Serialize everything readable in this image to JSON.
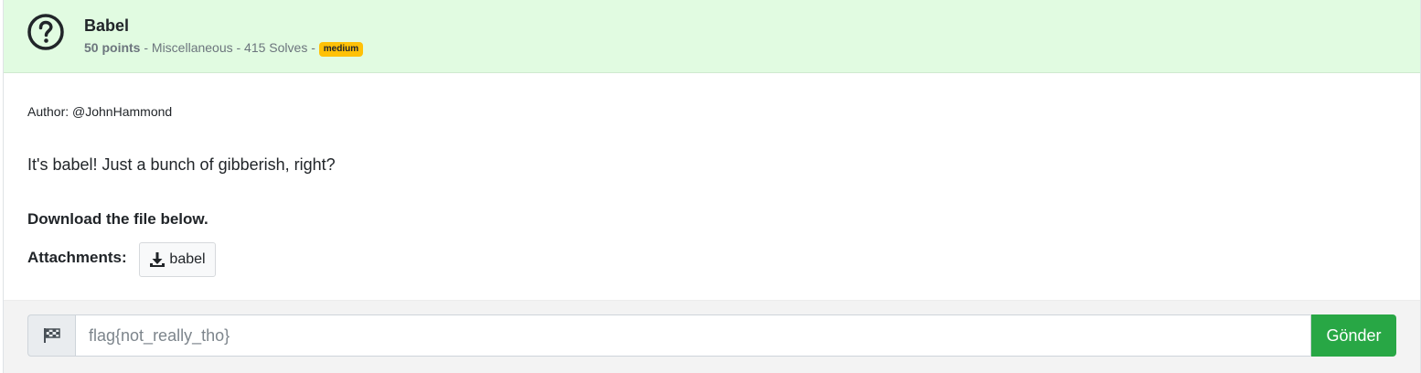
{
  "challenge": {
    "title": "Babel",
    "points": "50 points",
    "meta_rest": " - Miscellaneous - 415 Solves - ",
    "difficulty": "medium",
    "icon": "question-circle-icon"
  },
  "body": {
    "author": "Author: @JohnHammond",
    "description": "It's babel! Just a bunch of gibberish, right?",
    "download_note": "Download the file below.",
    "attachments_label": "Attachments:",
    "attachment_name": "babel",
    "attachment_icon": "download-icon"
  },
  "flag_form": {
    "icon": "flag-checkered-icon",
    "placeholder": "flag{not_really_tho}",
    "value": "",
    "submit_label": "Gönder"
  },
  "colors": {
    "header_bg": "#e1fbe1",
    "badge": "#ffc107",
    "submit": "#28a745"
  }
}
